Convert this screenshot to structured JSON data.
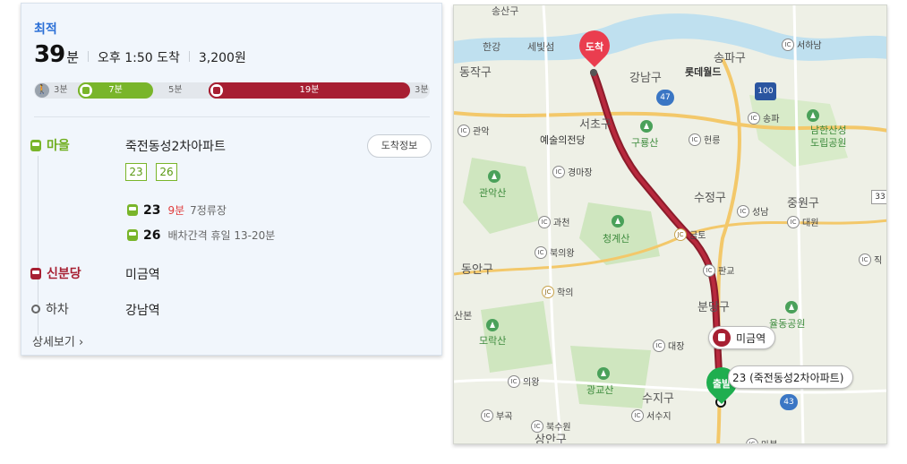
{
  "summary": {
    "best_label": "최적",
    "minutes": "39",
    "minutes_unit": "분",
    "arrival": "오후 1:50 도착",
    "fare": "3,200원"
  },
  "timeline": {
    "walk_start": "3분",
    "green_bus": "7분",
    "wait": "5분",
    "red_bus": "19분",
    "walk_end": "3분"
  },
  "steps": {
    "board": {
      "label": "마을",
      "stop": "죽전동성2차아파트",
      "button": "도착정보",
      "routes": [
        "23",
        "26"
      ]
    },
    "buses": [
      {
        "number": "23",
        "eta": "9분",
        "info": "7정류장"
      },
      {
        "number": "26",
        "eta": "",
        "info": "배차간격 휴일 13-20분"
      }
    ],
    "transfer": {
      "label": "신분당",
      "stop": "미금역"
    },
    "alight": {
      "label": "하차",
      "stop": "강남역"
    },
    "detail_link": "상세보기 ›"
  },
  "map": {
    "labels": {
      "l1": "한강",
      "l2": "세빛섬",
      "l3": "동작구",
      "l4": "강남구",
      "l5": "송파구",
      "l6": "롯데월드",
      "l7": "서초구",
      "l8": "예술의전당",
      "l9": "구룡산",
      "l10": "관악산",
      "l11": "수정구",
      "l12": "중원구",
      "l13": "남한산성",
      "l14": "도립공원",
      "l15": "청계산",
      "l16": "동안구",
      "l17": "분당구",
      "l18": "율동공원",
      "l19": "모락산",
      "l20": "광교산",
      "l21": "수지구",
      "l22": "상안구",
      "l23": "산본",
      "l24": "성남"
    },
    "ic": {
      "i1": "서하남",
      "i2": "관악",
      "i3": "경마장",
      "i4": "헌릉",
      "i5": "송파",
      "i6": "과천",
      "i7": "북의왕",
      "i8": "성남",
      "i9": "대원",
      "i10": "판교",
      "i11": "대장",
      "i12": "의왕",
      "i13": "부곡",
      "i14": "북수원",
      "i15": "서수지",
      "i16": "마북",
      "i17": "금토",
      "i18": "학의",
      "i19": "직"
    },
    "badges": {
      "b1": "47",
      "b2": "100",
      "b3": "43",
      "b4": "33"
    },
    "pins": {
      "arrive": "도착",
      "depart": "출발"
    },
    "callouts": {
      "station": "미금역",
      "bus": "23 (죽전동성2차아파트)"
    },
    "top_label": "송산구"
  }
}
